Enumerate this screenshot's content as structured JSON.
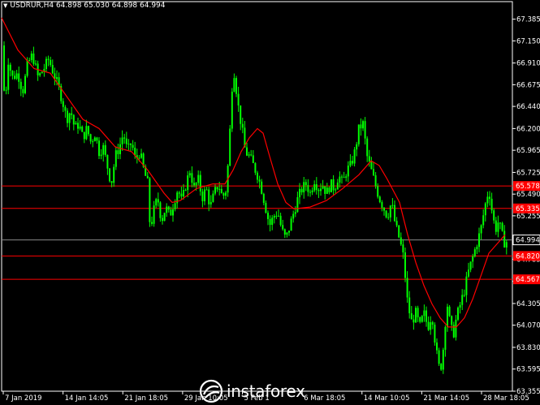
{
  "header": {
    "symbol": "USDRUR,H4",
    "ohlc": "64.898 65.030 64.898 64.994"
  },
  "colors": {
    "background": "#000000",
    "candles": "#00ff00",
    "moving_average": "#ff0000",
    "levels": "#ff0000",
    "axis": "#ffffff",
    "current_price": "#ffffff"
  },
  "logo": {
    "text": "instaforex"
  },
  "chart_data": {
    "type": "candlestick",
    "timeframe": "H4",
    "price_axis": {
      "min": 63.355,
      "max": 67.575,
      "ticks": [
        "67.385",
        "67.150",
        "66.910",
        "66.675",
        "66.440",
        "66.200",
        "65.965",
        "65.725",
        "65.490",
        "65.255",
        "65.020",
        "64.785",
        "64.545",
        "64.305",
        "64.070",
        "63.830",
        "63.595",
        "63.355"
      ]
    },
    "time_axis": {
      "ticks": [
        "7 Jan 2019",
        "14 Jan 14:05",
        "21 Jan 18:05",
        "29 Jan 10:05",
        "5 Feb 1",
        "6 Mar 18:05",
        "14 Mar 10:05",
        "21 Mar 14:05",
        "28 Mar 18:05"
      ]
    },
    "levels": [
      {
        "price": 65.578,
        "label": "65.578"
      },
      {
        "price": 65.335,
        "label": "65.335"
      },
      {
        "price": 64.82,
        "label": "64.820"
      },
      {
        "price": 64.567,
        "label": "64.567"
      }
    ],
    "current_price": {
      "price": 64.994,
      "label": "64.994"
    },
    "close_path": [
      [
        0,
        67.1
      ],
      [
        4,
        66.45
      ],
      [
        8,
        66.95
      ],
      [
        13,
        66.75
      ],
      [
        20,
        66.8
      ],
      [
        26,
        66.6
      ],
      [
        32,
        66.9
      ],
      [
        38,
        67.0
      ],
      [
        45,
        66.75
      ],
      [
        52,
        66.85
      ],
      [
        58,
        66.95
      ],
      [
        64,
        66.8
      ],
      [
        70,
        66.65
      ],
      [
        75,
        66.5
      ],
      [
        80,
        66.3
      ],
      [
        85,
        66.4
      ],
      [
        90,
        66.2
      ],
      [
        95,
        66.25
      ],
      [
        100,
        66.1
      ],
      [
        105,
        66.2
      ],
      [
        110,
        66.05
      ],
      [
        115,
        66.15
      ],
      [
        120,
        65.95
      ],
      [
        125,
        66.0
      ],
      [
        130,
        65.8
      ],
      [
        135,
        65.6
      ],
      [
        140,
        65.9
      ],
      [
        145,
        66.0
      ],
      [
        150,
        66.15
      ],
      [
        155,
        65.95
      ],
      [
        160,
        66.05
      ],
      [
        165,
        65.85
      ],
      [
        170,
        65.95
      ],
      [
        175,
        65.75
      ],
      [
        180,
        65.6
      ],
      [
        183,
        65.1
      ],
      [
        187,
        65.3
      ],
      [
        192,
        65.45
      ],
      [
        197,
        65.2
      ],
      [
        202,
        65.35
      ],
      [
        207,
        65.25
      ],
      [
        212,
        65.4
      ],
      [
        217,
        65.55
      ],
      [
        222,
        65.4
      ],
      [
        227,
        65.6
      ],
      [
        232,
        65.75
      ],
      [
        237,
        65.55
      ],
      [
        242,
        65.65
      ],
      [
        247,
        65.45
      ],
      [
        252,
        65.55
      ],
      [
        257,
        65.35
      ],
      [
        262,
        65.5
      ],
      [
        267,
        65.6
      ],
      [
        272,
        65.45
      ],
      [
        277,
        65.55
      ],
      [
        282,
        66.3
      ],
      [
        285,
        66.9
      ],
      [
        288,
        66.7
      ],
      [
        292,
        66.4
      ],
      [
        296,
        66.2
      ],
      [
        300,
        65.95
      ],
      [
        305,
        65.9
      ],
      [
        310,
        65.8
      ],
      [
        315,
        65.7
      ],
      [
        320,
        65.55
      ],
      [
        325,
        65.35
      ],
      [
        330,
        65.15
      ],
      [
        335,
        65.25
      ],
      [
        340,
        65.3
      ],
      [
        345,
        65.1
      ],
      [
        350,
        65.0
      ],
      [
        355,
        65.15
      ],
      [
        360,
        65.3
      ],
      [
        365,
        65.45
      ],
      [
        370,
        65.55
      ],
      [
        375,
        65.6
      ],
      [
        380,
        65.5
      ],
      [
        385,
        65.65
      ],
      [
        390,
        65.55
      ],
      [
        395,
        65.6
      ],
      [
        400,
        65.5
      ],
      [
        405,
        65.6
      ],
      [
        410,
        65.55
      ],
      [
        415,
        65.7
      ],
      [
        420,
        65.6
      ],
      [
        425,
        65.75
      ],
      [
        430,
        65.8
      ],
      [
        435,
        65.95
      ],
      [
        440,
        66.2
      ],
      [
        445,
        66.25
      ],
      [
        450,
        65.9
      ],
      [
        455,
        65.75
      ],
      [
        460,
        65.6
      ],
      [
        465,
        65.45
      ],
      [
        470,
        65.35
      ],
      [
        475,
        65.25
      ],
      [
        480,
        65.4
      ],
      [
        485,
        65.15
      ],
      [
        490,
        65.0
      ],
      [
        495,
        64.8
      ],
      [
        500,
        64.3
      ],
      [
        505,
        64.1
      ],
      [
        510,
        64.2
      ],
      [
        515,
        64.05
      ],
      [
        520,
        64.2
      ],
      [
        525,
        64.05
      ],
      [
        530,
        64.2
      ],
      [
        535,
        63.8
      ],
      [
        540,
        63.55
      ],
      [
        545,
        63.9
      ],
      [
        548,
        64.35
      ],
      [
        552,
        64.1
      ],
      [
        556,
        63.95
      ],
      [
        560,
        64.15
      ],
      [
        565,
        64.3
      ],
      [
        570,
        64.45
      ],
      [
        575,
        64.65
      ],
      [
        580,
        64.8
      ],
      [
        585,
        64.95
      ],
      [
        590,
        65.1
      ],
      [
        595,
        65.35
      ],
      [
        600,
        65.55
      ],
      [
        604,
        65.3
      ],
      [
        608,
        65.1
      ],
      [
        612,
        65.2
      ],
      [
        616,
        65.05
      ],
      [
        620,
        64.95
      ],
      [
        623,
        64.99
      ]
    ],
    "ma_path": [
      [
        0,
        67.4
      ],
      [
        20,
        67.05
      ],
      [
        40,
        66.85
      ],
      [
        60,
        66.8
      ],
      [
        80,
        66.55
      ],
      [
        100,
        66.3
      ],
      [
        120,
        66.2
      ],
      [
        140,
        66.0
      ],
      [
        160,
        65.95
      ],
      [
        180,
        65.75
      ],
      [
        200,
        65.5
      ],
      [
        210,
        65.4
      ],
      [
        220,
        65.42
      ],
      [
        240,
        65.55
      ],
      [
        260,
        65.6
      ],
      [
        275,
        65.6
      ],
      [
        285,
        65.75
      ],
      [
        295,
        65.95
      ],
      [
        305,
        66.1
      ],
      [
        315,
        66.2
      ],
      [
        322,
        66.15
      ],
      [
        330,
        65.9
      ],
      [
        340,
        65.6
      ],
      [
        350,
        65.4
      ],
      [
        360,
        65.33
      ],
      [
        380,
        65.35
      ],
      [
        400,
        65.42
      ],
      [
        420,
        65.55
      ],
      [
        440,
        65.7
      ],
      [
        455,
        65.85
      ],
      [
        465,
        65.8
      ],
      [
        475,
        65.65
      ],
      [
        490,
        65.4
      ],
      [
        500,
        65.05
      ],
      [
        510,
        64.75
      ],
      [
        520,
        64.5
      ],
      [
        530,
        64.3
      ],
      [
        540,
        64.15
      ],
      [
        550,
        64.05
      ],
      [
        560,
        64.05
      ],
      [
        570,
        64.15
      ],
      [
        580,
        64.35
      ],
      [
        590,
        64.6
      ],
      [
        600,
        64.85
      ],
      [
        610,
        64.95
      ],
      [
        620,
        65.05
      ]
    ]
  }
}
